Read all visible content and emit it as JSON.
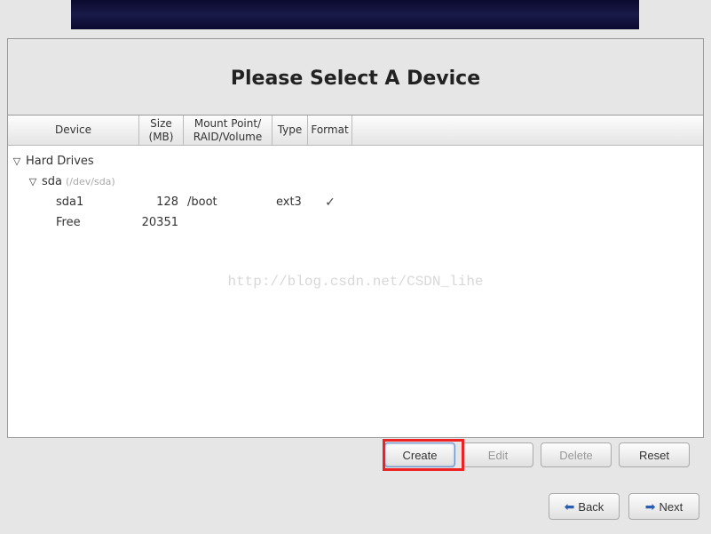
{
  "title": "Please Select A Device",
  "headers": {
    "device": "Device",
    "size": "Size\n(MB)",
    "mount": "Mount Point/\nRAID/Volume",
    "type": "Type",
    "format": "Format"
  },
  "tree": {
    "root_label": "Hard Drives",
    "disk": {
      "name": "sda",
      "path": "(/dev/sda)"
    },
    "rows": [
      {
        "name": "sda1",
        "size": "128",
        "mount": "/boot",
        "type": "ext3",
        "format": "✓"
      },
      {
        "name": "Free",
        "size": "20351",
        "mount": "",
        "type": "",
        "format": ""
      }
    ]
  },
  "watermark": "http://blog.csdn.net/CSDN_lihe",
  "buttons": {
    "create": "Create",
    "edit": "Edit",
    "delete": "Delete",
    "reset": "Reset"
  },
  "nav": {
    "back": "Back",
    "next": "Next"
  }
}
